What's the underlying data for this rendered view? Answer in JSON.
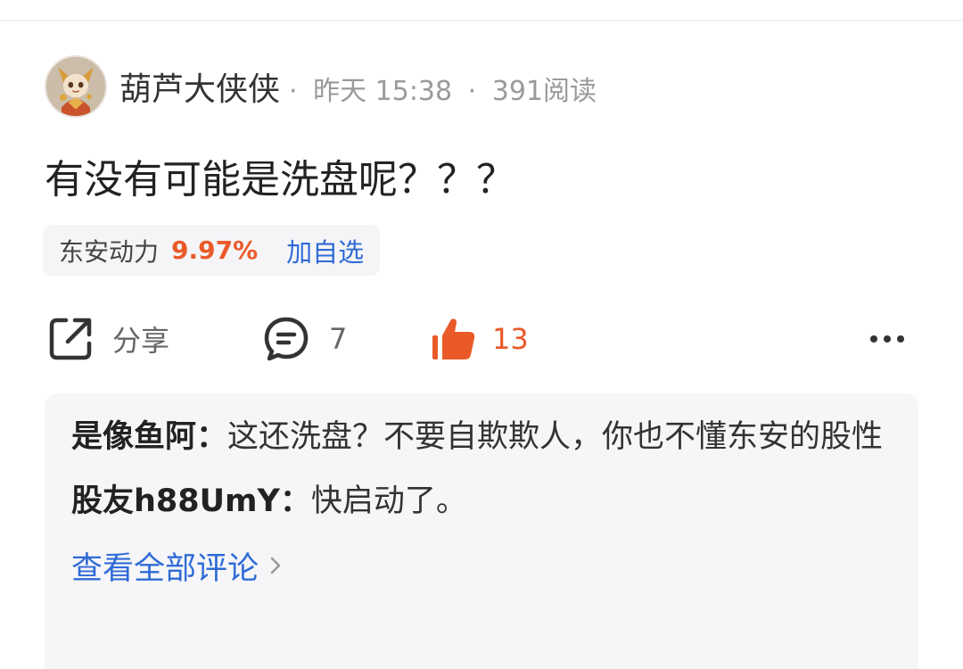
{
  "post": {
    "author": "葫芦大侠侠",
    "sep1": "·",
    "time": "昨天 15:38",
    "sep2": "·",
    "reads": "391阅读",
    "title": "有没有可能是洗盘呢？？？"
  },
  "stock": {
    "name": "东安动力",
    "change": "9.97%",
    "add_label": "加自选",
    "change_color": "#ea5a29"
  },
  "actions": {
    "share_label": "分享",
    "comment_count": "7",
    "like_count": "13",
    "share_icon": "share-icon",
    "comment_icon": "comment-icon",
    "like_icon": "thumbs-up-icon",
    "more_icon": "more-icon",
    "accent_color": "#ea5a29"
  },
  "comments": [
    {
      "name": "是像鱼阿：",
      "text": "这还洗盘？不要自欺欺人，你也不懂东安的股性"
    },
    {
      "name": "股友h88UmY：",
      "text": "快启动了。"
    }
  ],
  "view_all": "查看全部评论",
  "link_color": "#2f6bd6"
}
